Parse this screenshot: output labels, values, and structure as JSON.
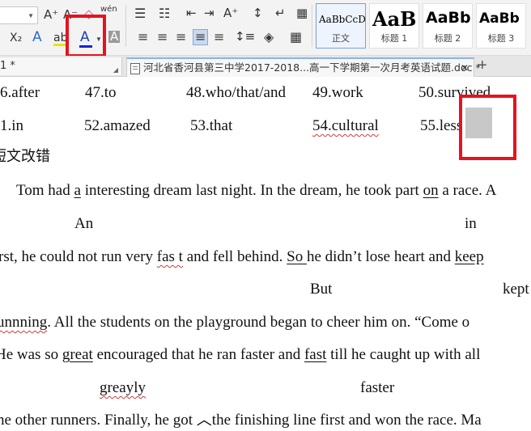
{
  "toolbar": {
    "font_size_value": "",
    "row1": {
      "grow_font": "A⁺",
      "shrink_font": "A⁻",
      "clear_format": "◇",
      "phonetic": "wén",
      "bullets": "☰",
      "numbering": "☷",
      "decrease_indent": "⇤",
      "increase_indent": "⇥",
      "font_size_box": "A⁺",
      "sort": "↕",
      "show_marks": "↵",
      "table": "▦"
    },
    "row2": {
      "subscript": "X₂",
      "text_effect": "A",
      "highlight": "ab",
      "font_color_label": "A",
      "char_shading": "A",
      "align_left": "≡",
      "align_center": "≡",
      "align_right": "≡",
      "justify": "≡",
      "distributed": "≡",
      "line_spacing": "↕≡",
      "shading": "◈",
      "borders": "▦"
    },
    "styles": [
      {
        "sample": "AaBbCcD",
        "name": "正文"
      },
      {
        "sample": "AaB",
        "name": "标题 1"
      },
      {
        "sample": "AaBb",
        "name": "标题 2"
      },
      {
        "sample": "AaBb",
        "name": "标题 3"
      }
    ],
    "accent_color": "#0a24d6",
    "highlight_color": "#e4141f"
  },
  "tabs": {
    "first_label": "1 *",
    "second_label": "河北省香河县第三中学2017-2018...高一下学期第一次月考英语试题.doc *",
    "close_symbol": "✕",
    "add_symbol": "+"
  },
  "document": {
    "answers_row1": [
      "6.after",
      "47.to",
      "48.who/that/and",
      "49.work",
      "50.survived"
    ],
    "answers_row2": [
      "1.in",
      "52.amazed",
      "53.that",
      "54.cultural",
      "55.less"
    ],
    "section_heading": "短文改错",
    "lines": {
      "l1": {
        "pre": "Tom had ",
        "a": "a",
        "mid": " interesting dream last night. In the dream, he took part ",
        "on": "on",
        "post": " a race. A"
      },
      "c1": [
        "An",
        "in"
      ],
      "l2": {
        "pre": "rst, he could not run very ",
        "fast": "fas t",
        "mid": " and fell behind. ",
        "so": "So ",
        "mid2": "he didn’t lose heart and ",
        "keep": "keep"
      },
      "c2": [
        "But",
        "kept"
      ],
      "l3": {
        "runn": "unnning",
        "post": ". All the students on the playground began to cheer him on. “Come o"
      },
      "l4": {
        "pre": "He was so ",
        "great": "great",
        "mid": " encouraged that he ran faster and ",
        "fast": "fast",
        "post": " till he caught up with all"
      },
      "c4": [
        "greayly",
        "faster"
      ],
      "l5": {
        "pre": "he other runners. Finally, he got ",
        "caret": "︿",
        "post": "the finishing line first and won the race. Ma"
      }
    }
  }
}
